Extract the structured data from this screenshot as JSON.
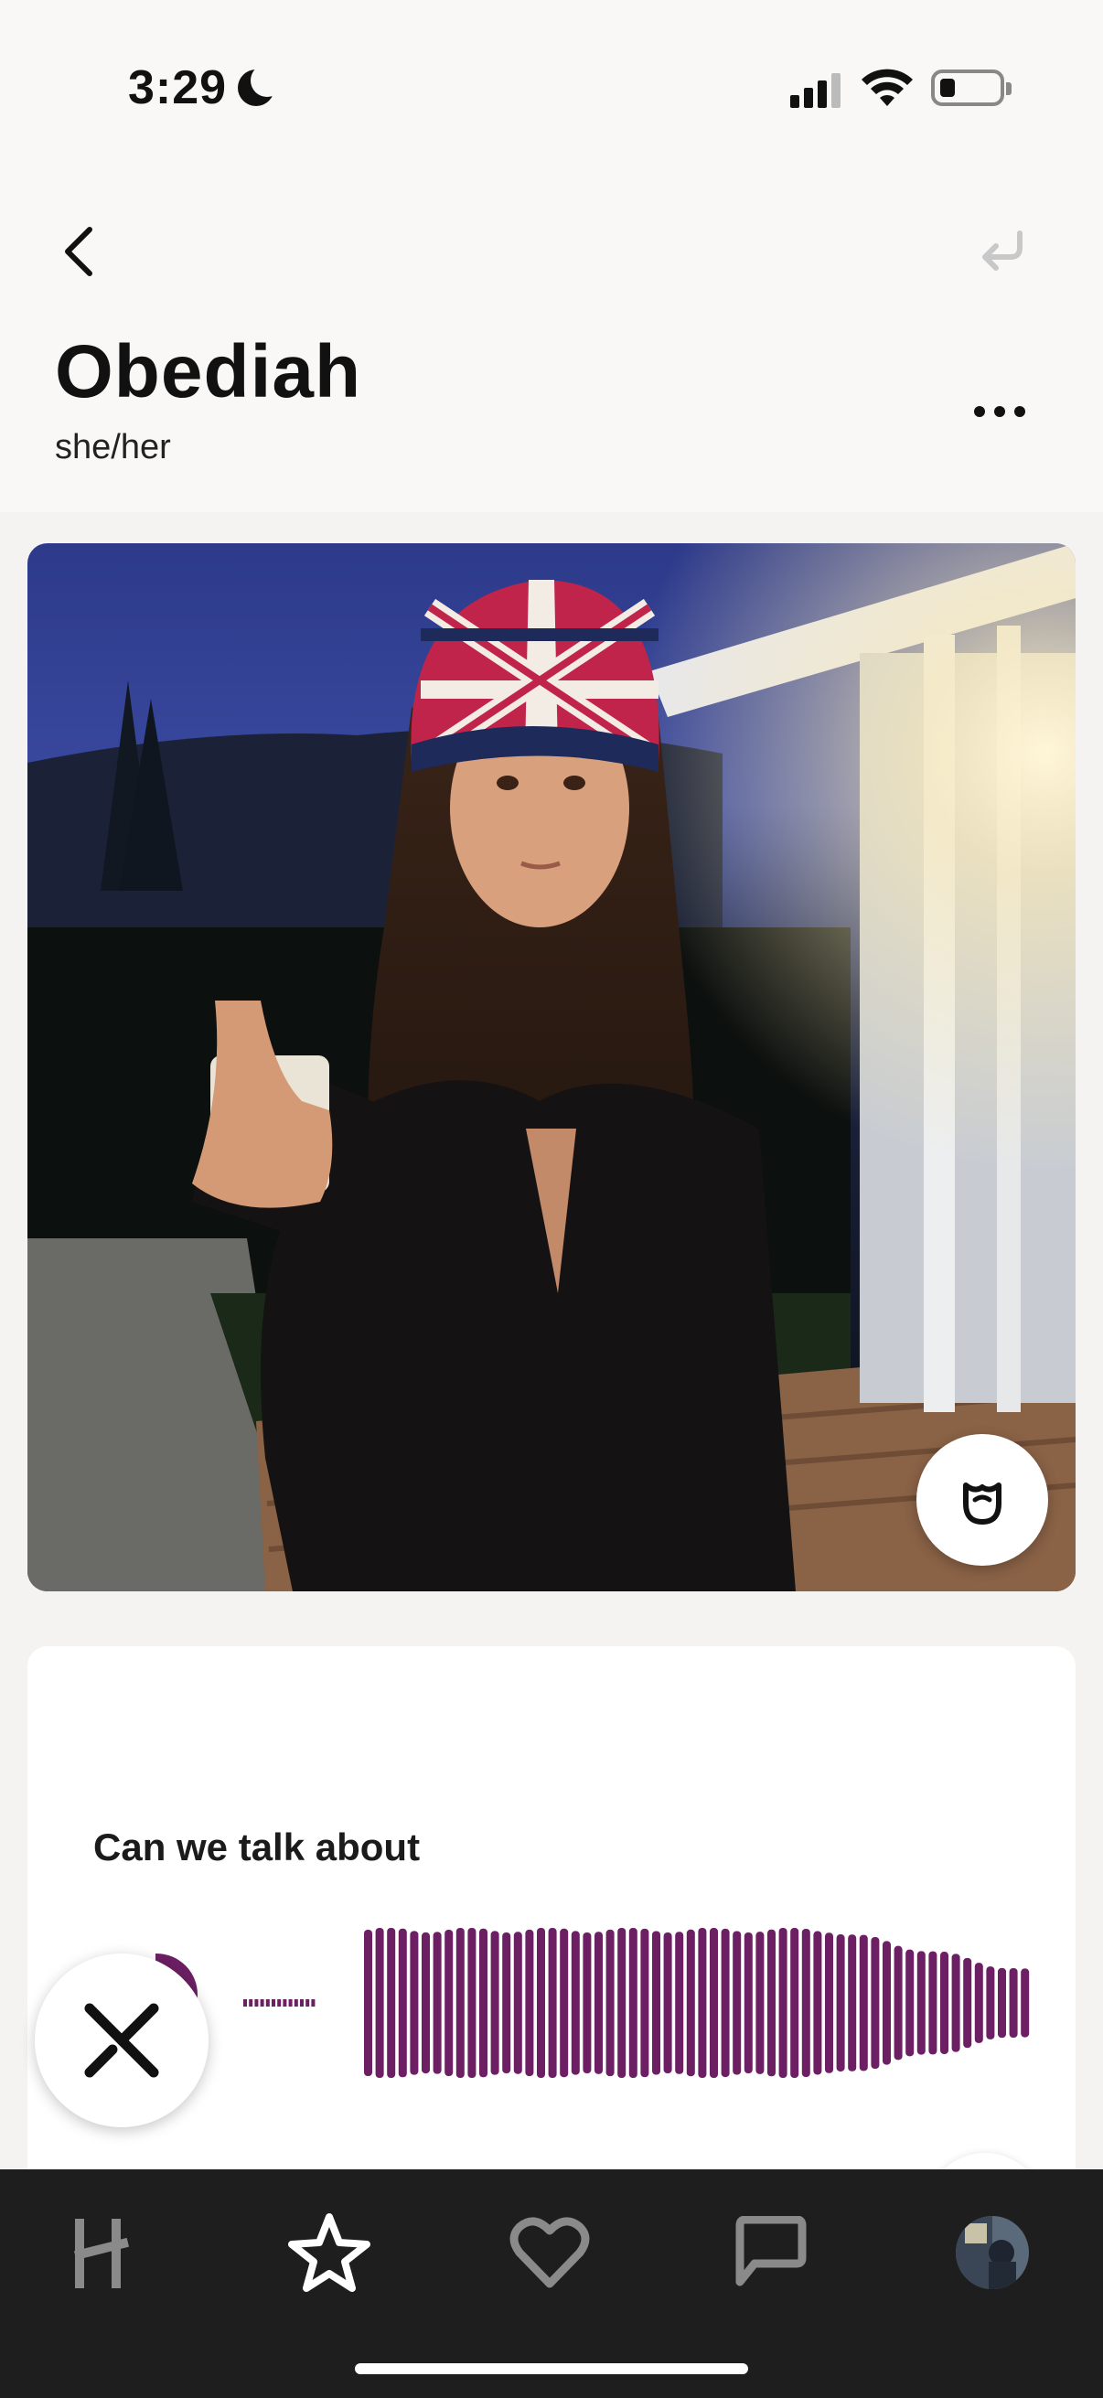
{
  "status_bar": {
    "time": "3:29",
    "focus_icon": "moon-icon",
    "signal_icon": "cellular-signal-icon",
    "wifi_icon": "wifi-icon",
    "battery_icon": "battery-icon",
    "battery_level": 0.25
  },
  "header": {
    "back_icon": "chevron-left-icon",
    "undo_icon": "undo-arrow-icon",
    "name": "Obediah",
    "pronouns": "she/her",
    "more_icon": "ellipsis-icon"
  },
  "photo": {
    "description_icon": "profile-photo",
    "rose_icon": "rose-icon"
  },
  "prompt": {
    "question": "Can we talk about",
    "play_icon": "play-icon",
    "waveform_color": "#6c1f63"
  },
  "actions": {
    "dismiss_icon": "close-x-icon"
  },
  "tabbar": {
    "tabs": [
      {
        "icon": "hinge-logo-icon",
        "active": false
      },
      {
        "icon": "star-icon",
        "active": true
      },
      {
        "icon": "heart-icon",
        "active": false
      },
      {
        "icon": "chat-bubble-icon",
        "active": false
      },
      {
        "icon": "profile-avatar",
        "active": false
      }
    ]
  },
  "colors": {
    "accent": "#6c1f63",
    "tabbar_bg": "#1e1e1e",
    "tab_inactive": "#8a8a8a",
    "tab_active": "#ffffff"
  }
}
